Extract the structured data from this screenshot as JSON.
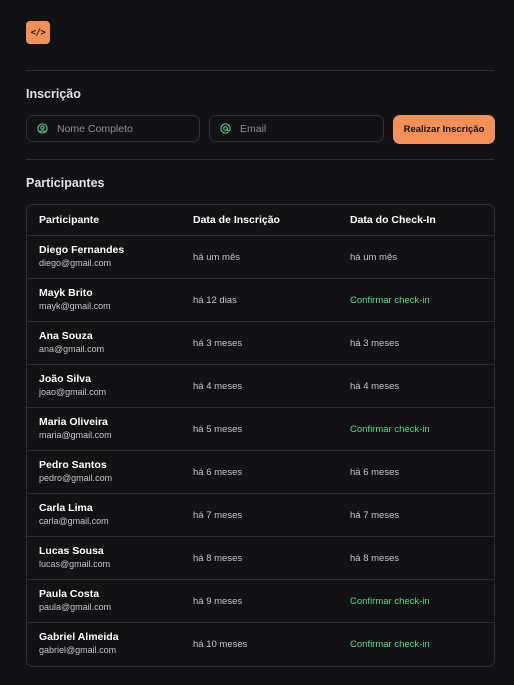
{
  "logo": {
    "text": "</>"
  },
  "form": {
    "title": "Inscrição",
    "name_placeholder": "Nome Completo",
    "email_placeholder": "Email",
    "submit_label": "Realizar Inscrição"
  },
  "participants": {
    "title": "Participantes",
    "headers": [
      "Participante",
      "Data de Inscrição",
      "Data do Check-In"
    ],
    "rows": [
      {
        "name": "Diego Fernandes",
        "email": "diego@gmail.com",
        "subscribed": "há um mês",
        "checkin": "há um mês",
        "confirm": false
      },
      {
        "name": "Mayk Brito",
        "email": "mayk@gmail.com",
        "subscribed": "há 12 dias",
        "checkin": "Confirmar check-in",
        "confirm": true
      },
      {
        "name": "Ana Souza",
        "email": "ana@gmail.com",
        "subscribed": "há 3 meses",
        "checkin": "há 3 meses",
        "confirm": false
      },
      {
        "name": "João Silva",
        "email": "joao@gmail.com",
        "subscribed": "há 4 meses",
        "checkin": "há 4 meses",
        "confirm": false
      },
      {
        "name": "Maria Oliveira",
        "email": "maria@gmail.com",
        "subscribed": "há 5 meses",
        "checkin": "Confirmar check-in",
        "confirm": true
      },
      {
        "name": "Pedro Santos",
        "email": "pedro@gmail.com",
        "subscribed": "há 6 meses",
        "checkin": "há 6 meses",
        "confirm": false
      },
      {
        "name": "Carla Lima",
        "email": "carla@gmail.com",
        "subscribed": "há 7 meses",
        "checkin": "há 7 meses",
        "confirm": false
      },
      {
        "name": "Lucas Sousa",
        "email": "lucas@gmail.com",
        "subscribed": "há 8 meses",
        "checkin": "há 8 meses",
        "confirm": false
      },
      {
        "name": "Paula Costa",
        "email": "paula@gmail.com",
        "subscribed": "há 9 meses",
        "checkin": "Confirmar check-in",
        "confirm": true
      },
      {
        "name": "Gabriel Almeida",
        "email": "gabriel@gmail.com",
        "subscribed": "há 10 meses",
        "checkin": "Confirmar check-in",
        "confirm": true
      }
    ]
  },
  "colors": {
    "background": "#121214",
    "accent": "#f48f56",
    "confirm": "#4ade80",
    "border": "#2c2c32"
  },
  "icons": {
    "name_field": "user-circle-icon",
    "email_field": "at-sign-icon"
  }
}
